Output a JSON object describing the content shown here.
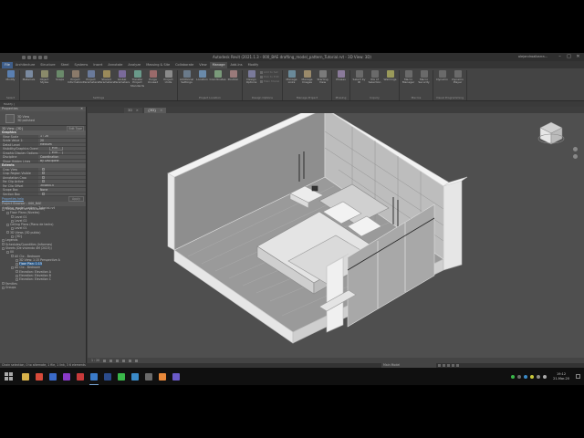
{
  "window": {
    "title": "Autodesk Revit (2021.1.3 - 000_BAE drafting_model_pattern_Tutorial.rvt - 3D View: 3D)",
    "user": "alejandroalbarra...",
    "controls": [
      "–",
      "□",
      "✕"
    ]
  },
  "ribbon_tabs": [
    "File",
    "Architecture",
    "Structure",
    "Steel",
    "Systems",
    "Insert",
    "Annotate",
    "Analyze",
    "Massing & Site",
    "Collaborate",
    "View",
    "Manage",
    "Add-Ins",
    "Modify"
  ],
  "active_tab": "Manage",
  "ribbon": {
    "groups": [
      {
        "name": "Select",
        "buttons": [
          {
            "label": "Modify",
            "color": "#5a7fb0"
          }
        ]
      },
      {
        "name": "Settings",
        "buttons": [
          {
            "label": "Materials",
            "color": "#7a8aa0"
          },
          {
            "label": "Object Styles",
            "color": "#8a8a6a"
          },
          {
            "label": "Snaps",
            "color": "#6a8a6a"
          },
          {
            "label": "Project Information",
            "color": "#8a7a6a"
          },
          {
            "label": "Project Parameters",
            "color": "#6a7a9a"
          },
          {
            "label": "Shared Parameters",
            "color": "#9a8a5a"
          },
          {
            "label": "Global Parameters",
            "color": "#7a6a9a"
          },
          {
            "label": "Transfer Project Standards",
            "color": "#6a9a8a"
          },
          {
            "label": "Purge Unused",
            "color": "#9a6a6a"
          },
          {
            "label": "Project Units",
            "color": "#8a8a8a"
          }
        ]
      },
      {
        "name": "Project Location",
        "buttons": [
          {
            "label": "Additional Settings",
            "color": "#6a7a8a"
          },
          {
            "label": "Location",
            "color": "#6a8aaa"
          },
          {
            "label": "Coordinates",
            "color": "#7a9a7a"
          },
          {
            "label": "Position",
            "color": "#9a7a7a"
          }
        ]
      },
      {
        "name": "Design Options",
        "buttons": [
          {
            "label": "Design Options",
            "color": "#7a7a9a"
          }
        ],
        "small": [
          "Add to Set",
          "Pick to Edit",
          "Main Model"
        ]
      },
      {
        "name": "Manage Project",
        "buttons": [
          {
            "label": "Manage Links",
            "color": "#6a8a9a"
          },
          {
            "label": "Manage Images",
            "color": "#9a8a6a"
          },
          {
            "label": "Starting View",
            "color": "#7a7a7a"
          }
        ]
      },
      {
        "name": "Phasing",
        "buttons": [
          {
            "label": "Phases",
            "color": "#8a7a9a"
          }
        ]
      },
      {
        "name": "Inquiry",
        "buttons": [
          {
            "label": "Select by ID",
            "color": "#6a6a6a"
          },
          {
            "label": "IDs of Selection",
            "color": "#6a6a6a"
          },
          {
            "label": "Warnings",
            "color": "#9a9a5a"
          }
        ]
      },
      {
        "name": "Macros",
        "buttons": [
          {
            "label": "Macro Manager",
            "color": "#6a6a6a"
          },
          {
            "label": "Macro Security",
            "color": "#6a6a6a"
          }
        ]
      },
      {
        "name": "Visual Programming",
        "buttons": [
          {
            "label": "Dynamo",
            "color": "#6a6a6a"
          },
          {
            "label": "Dynamo Player",
            "color": "#6a6a6a"
          }
        ]
      }
    ]
  },
  "options_bar": "Modify |",
  "properties": {
    "header": "Properties",
    "type_name": "3D View",
    "type_sub": "3D polished",
    "instance_selector": "3D View: {3D}",
    "edit_type": "Edit Type",
    "categories": [
      {
        "name": "Graphics",
        "rows": [
          {
            "k": "View Scale",
            "v": "1 : 20"
          },
          {
            "k": "Scale Value 1:",
            "v": "20"
          },
          {
            "k": "Detail Level",
            "v": "Medium"
          },
          {
            "k": "Visibility/Graphics Overrides",
            "v": "",
            "btn": "Edit..."
          },
          {
            "k": "Graphic Display Options",
            "v": "",
            "btn": "Edit..."
          },
          {
            "k": "Discipline",
            "v": "Coordination"
          },
          {
            "k": "Show Hidden Lines",
            "v": "By Discipline"
          }
        ]
      },
      {
        "name": "Extents",
        "rows": [
          {
            "k": "Crop View",
            "v": "",
            "check": true
          },
          {
            "k": "Crop Region Visible",
            "v": "",
            "check": true
          },
          {
            "k": "Annotation Crop",
            "v": "",
            "check": true
          },
          {
            "k": "Far Clip Active",
            "v": "",
            "check": true
          },
          {
            "k": "Far Clip Offset",
            "v": "304800.0"
          },
          {
            "k": "Scope Box",
            "v": "None"
          },
          {
            "k": "Section Box",
            "v": "",
            "check": true
          }
        ]
      }
    ],
    "help_link": "Properties help",
    "apply": "Apply"
  },
  "project_browser": {
    "header": "Project Browser - 000_BAE drafting_model_pattern_Tutorial.rvt",
    "nodes": [
      {
        "label": "Views (Revit en valoración)",
        "level": 0
      },
      {
        "label": "Floor Plans (Niveles)",
        "level": 1
      },
      {
        "label": "Level 01",
        "level": 2
      },
      {
        "label": "Level 02",
        "level": 2
      },
      {
        "label": "Ceiling Plans (Plano de techo)",
        "level": 1
      },
      {
        "label": "Level 01",
        "level": 2
      },
      {
        "label": "3D Views (3D pulido)",
        "level": 1
      },
      {
        "label": "{3D}",
        "level": 2
      },
      {
        "label": "Legends",
        "level": 0
      },
      {
        "label": "Schedules/Quantities (Informes)",
        "level": 0
      },
      {
        "label": "Sheets (De viviendo 4M (2023))",
        "level": 0
      },
      {
        "label": "00",
        "level": 1
      },
      {
        "label": "A0 Ctx - Bedroom",
        "level": 2
      },
      {
        "label": "3D View: 1:15 Perspective A",
        "level": 3
      },
      {
        "label": "Floor Plan: 1:15",
        "level": 3,
        "selected": true
      },
      {
        "label": "A0 Ctx - Bedroom",
        "level": 2
      },
      {
        "label": "Elevation: Elevation A",
        "level": 3
      },
      {
        "label": "Elevation: Elevation B",
        "level": 3
      },
      {
        "label": "Elevation: Elevation C",
        "level": 3
      },
      {
        "label": "Families",
        "level": 0
      },
      {
        "label": "Groups",
        "level": 0
      }
    ]
  },
  "view_tabs": [
    {
      "label": "3D",
      "active": false
    },
    {
      "label": "{3D}",
      "active": true
    }
  ],
  "view_control": {
    "scale": "1 : 20"
  },
  "status": {
    "text": "Chain selection, 0 to alternate, 1 file, 1 link, 3 6 elements",
    "model": "Main Model"
  },
  "taskbar": {
    "apps": [
      {
        "name": "file-explorer",
        "color": "#d8b24a"
      },
      {
        "name": "chrome",
        "color": "#d84a3a"
      },
      {
        "name": "word",
        "color": "#3a6ac8"
      },
      {
        "name": "onenote",
        "color": "#8a3ac8"
      },
      {
        "name": "autocad",
        "color": "#c83a3a"
      },
      {
        "name": "revit",
        "color": "#3a7ac8",
        "active": true
      },
      {
        "name": "photoshop",
        "color": "#2a4a8a"
      },
      {
        "name": "spotify",
        "color": "#3ab84a"
      },
      {
        "name": "edge",
        "color": "#3a8ac8"
      },
      {
        "name": "calculator",
        "color": "#6a6a6a"
      },
      {
        "name": "vlc",
        "color": "#e8883a"
      },
      {
        "name": "teams",
        "color": "#6a5ac8"
      }
    ],
    "tray_colors": [
      "#3ab84a",
      "#6a6a6a",
      "#3a8ac8",
      "#c8c83a",
      "#8a8a8a",
      "#aaaaaa"
    ],
    "time": "19:12",
    "date": "21-Mar-20"
  }
}
